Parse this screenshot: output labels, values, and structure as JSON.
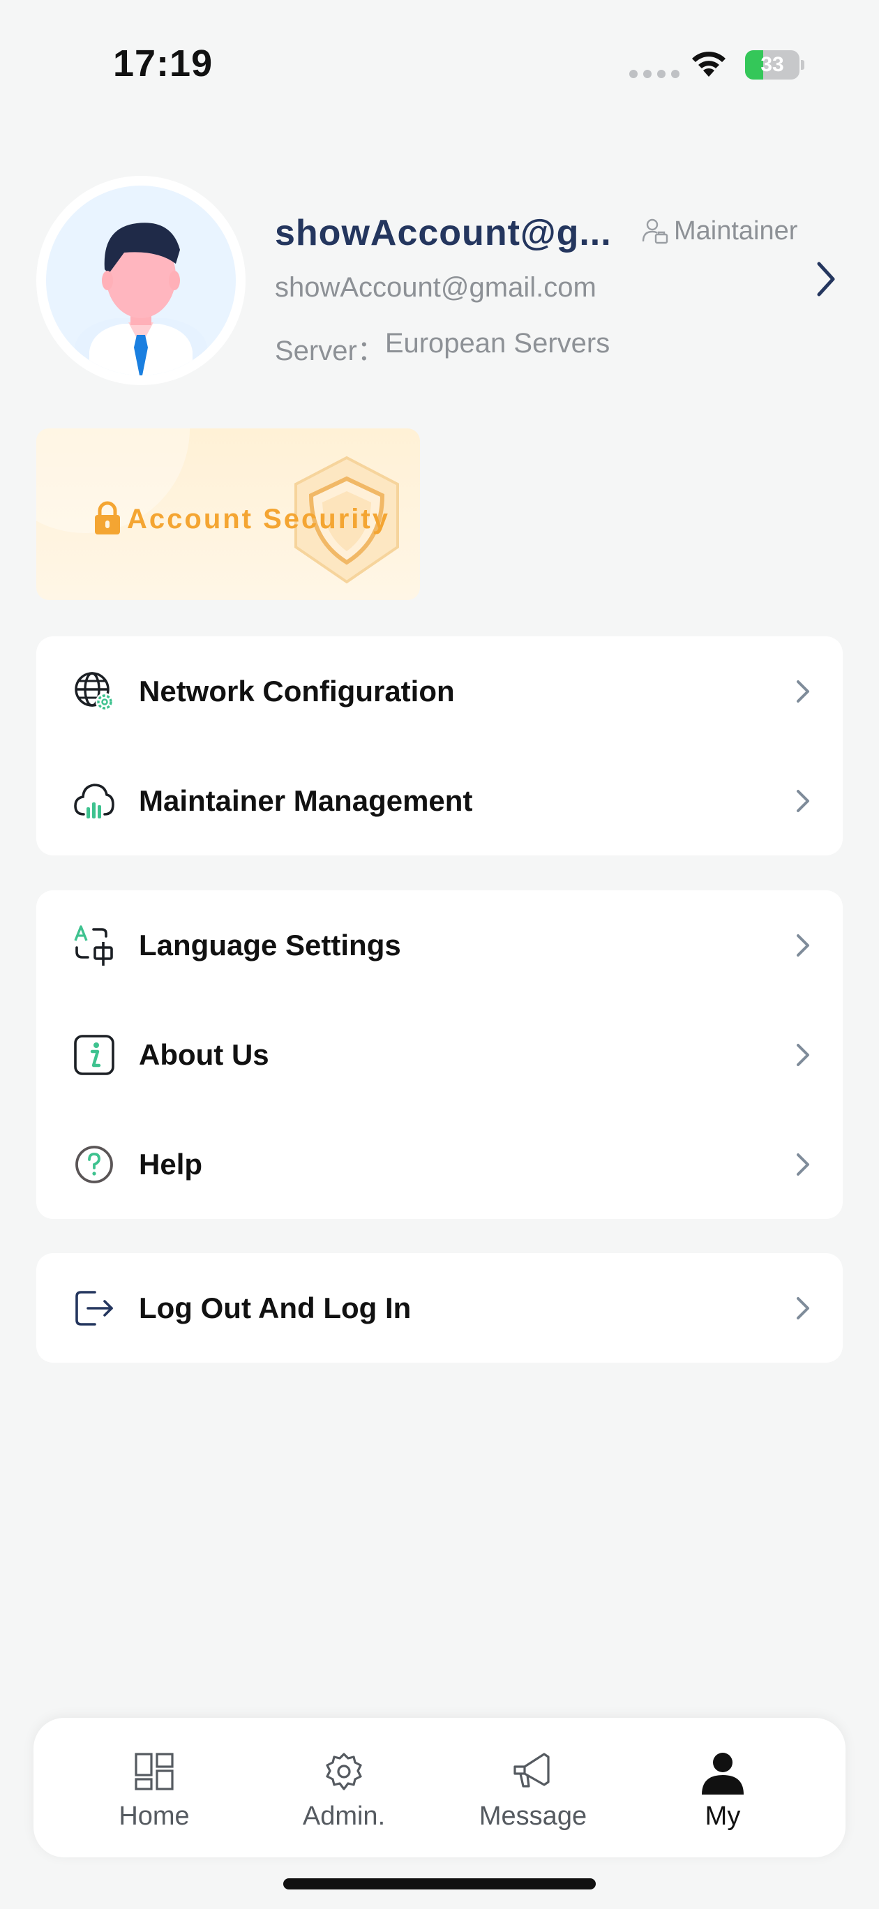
{
  "status_bar": {
    "time": "17:19",
    "battery": "33",
    "battery_level": 0.33
  },
  "profile": {
    "name": "showAccount@g...",
    "role": "Maintainer",
    "email": "showAccount@gmail.com",
    "server_label": "Server：",
    "server_value": "European Servers"
  },
  "security_card": {
    "label": "Account Security"
  },
  "menu_groups": [
    {
      "items": [
        {
          "label": "Network Configuration",
          "icon": "globe-gear-icon"
        },
        {
          "label": "Maintainer Management",
          "icon": "cloud-chart-icon"
        }
      ]
    },
    {
      "items": [
        {
          "label": "Language Settings",
          "icon": "translate-icon"
        },
        {
          "label": "About Us",
          "icon": "info-icon"
        },
        {
          "label": "Help",
          "icon": "help-icon"
        }
      ]
    },
    {
      "items": [
        {
          "label": "Log Out And Log In",
          "icon": "logout-icon"
        }
      ]
    }
  ],
  "tabbar": {
    "tabs": [
      {
        "label": "Home",
        "icon": "dashboard-icon",
        "active": false
      },
      {
        "label": "Admin.",
        "icon": "gear-icon",
        "active": false
      },
      {
        "label": "Message",
        "icon": "megaphone-icon",
        "active": false
      },
      {
        "label": "My",
        "icon": "person-icon",
        "active": true
      }
    ]
  },
  "colors": {
    "background": "#f5f6f6",
    "name": "#24365e",
    "secondary_text": "#8d9196",
    "accent_green": "#3ec28f",
    "security_orange": "#f4a532",
    "battery_green": "#34c759"
  }
}
